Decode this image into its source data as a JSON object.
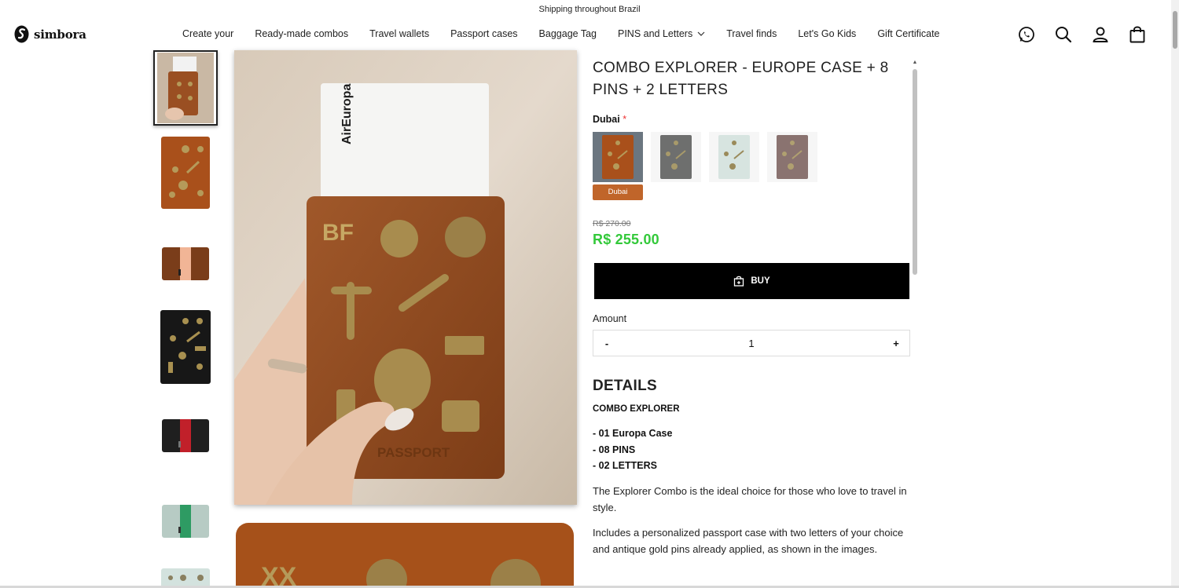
{
  "announcement": "Shipping throughout Brazil",
  "brand": {
    "name": "simbora"
  },
  "nav": {
    "items": [
      {
        "label": "Create your"
      },
      {
        "label": "Ready-made combos"
      },
      {
        "label": "Travel wallets"
      },
      {
        "label": "Passport cases"
      },
      {
        "label": "Baggage Tag"
      },
      {
        "label": "PINS and Letters"
      },
      {
        "label": "Travel finds"
      },
      {
        "label": "Let's Go Kids"
      },
      {
        "label": "Gift Certificate"
      }
    ]
  },
  "header_icons": [
    "whatsapp-icon",
    "search-icon",
    "account-icon",
    "cart-icon"
  ],
  "product": {
    "title": "COMBO EXPLORER - EUROPE CASE + 8 PINS + 2 LETTERS",
    "variant_label": "Dubai",
    "required_mark": "*",
    "selected_variant_tip": "Dubai",
    "price_old": "R$ 270.00",
    "price_new": "R$ 255.00",
    "buy_label": "BUY",
    "amount_label": "Amount",
    "quantity": "1",
    "minus": "-",
    "plus": "+",
    "details_heading": "DETAILS",
    "combo_name": "COMBO EXPLORER",
    "items": [
      "- 01 Europa Case",
      "- 08 PINS",
      "- 02 LETTERS"
    ],
    "paragraphs": [
      "The Explorer Combo is the ideal choice for those who love to travel in style.",
      "Includes a personalized passport case with two letters of your choice and antique gold pins already applied, as shown in the images."
    ]
  },
  "main_image": {
    "letters": "BF",
    "ticket_airline": "AirEuropa",
    "case_text": "PASSPORT"
  },
  "second_image": {
    "letters": "XX"
  },
  "colors": {
    "accent": "#33c93a",
    "buy": "#000000",
    "tip": "#c0652a",
    "leather": "#9a4f22"
  }
}
